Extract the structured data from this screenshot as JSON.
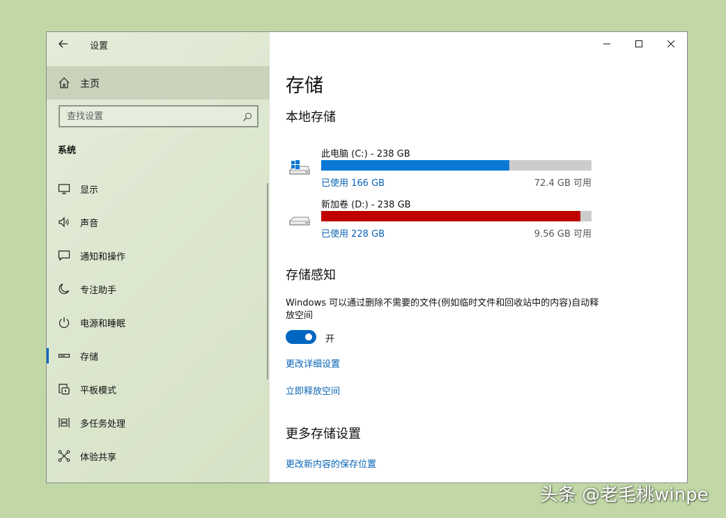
{
  "colors": {
    "accent": "#0067c0",
    "link": "#0a64b4",
    "drive_c_fill": "#0a78d4",
    "drive_d_fill": "#c00000",
    "bar_track": "#cccccc",
    "desktop": "#c1d8a6"
  },
  "titlebar": {
    "back_icon": "back-arrow-icon",
    "title": "设置",
    "controls": [
      "minimize-icon",
      "maximize-icon",
      "close-icon"
    ]
  },
  "sidebar": {
    "home": {
      "icon": "home-icon",
      "label": "主页"
    },
    "search": {
      "placeholder": "查找设置",
      "value": "",
      "icon": "search-icon"
    },
    "section": "系统",
    "items": [
      {
        "icon": "display-icon",
        "label": "显示"
      },
      {
        "icon": "sound-icon",
        "label": "声音"
      },
      {
        "icon": "notification-icon",
        "label": "通知和操作"
      },
      {
        "icon": "focus-moon-icon",
        "label": "专注助手"
      },
      {
        "icon": "power-icon",
        "label": "电源和睡眠"
      },
      {
        "icon": "storage-icon",
        "label": "存储",
        "active": true
      },
      {
        "icon": "tablet-icon",
        "label": "平板模式"
      },
      {
        "icon": "multitask-icon",
        "label": "多任务处理"
      },
      {
        "icon": "share-icon",
        "label": "体验共享"
      }
    ]
  },
  "main": {
    "title": "存储",
    "local_storage": {
      "heading": "本地存储",
      "drives": [
        {
          "icon": "windows-drive-icon",
          "name": "此电脑 (C:) - 238 GB",
          "used": "已使用 166 GB",
          "free": "72.4 GB 可用",
          "used_fraction": 0.697
        },
        {
          "icon": "drive-icon",
          "name": "新加卷 (D:) - 238 GB",
          "used": "已使用 228 GB",
          "free": "9.56 GB 可用",
          "used_fraction": 0.96
        }
      ]
    },
    "storage_sense": {
      "heading": "存储感知",
      "description": "Windows 可以通过删除不需要的文件(例如临时文件和回收站中的内容)自动释放空间",
      "toggle_on": true,
      "toggle_label": "开",
      "link_details": "更改详细设置",
      "link_free_now": "立即释放空间"
    },
    "more_settings": {
      "heading": "更多存储设置",
      "link_save_location": "更改新内容的保存位置"
    }
  },
  "watermark": "头条 @老毛桃winpe"
}
